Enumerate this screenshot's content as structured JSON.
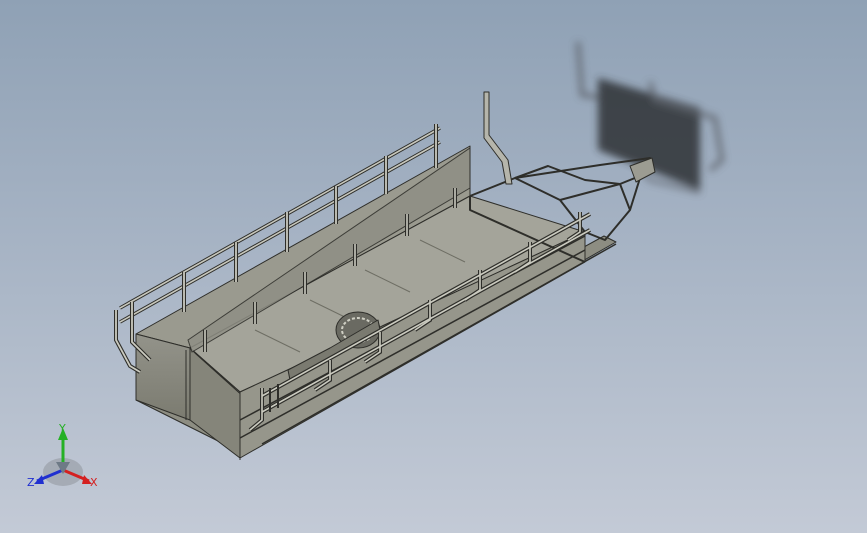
{
  "viewport": {
    "background_top": "#8fa1b5",
    "background_bottom": "#c3cad6",
    "model_color": "#8a8a7a",
    "rail_color": "#b9b9ae",
    "edge_color": "#2e2e2a"
  },
  "triad": {
    "x_label": "X",
    "y_label": "Y",
    "z_label": "Z",
    "x_color": "#d42020",
    "y_color": "#25b025",
    "z_color": "#2030d0"
  }
}
